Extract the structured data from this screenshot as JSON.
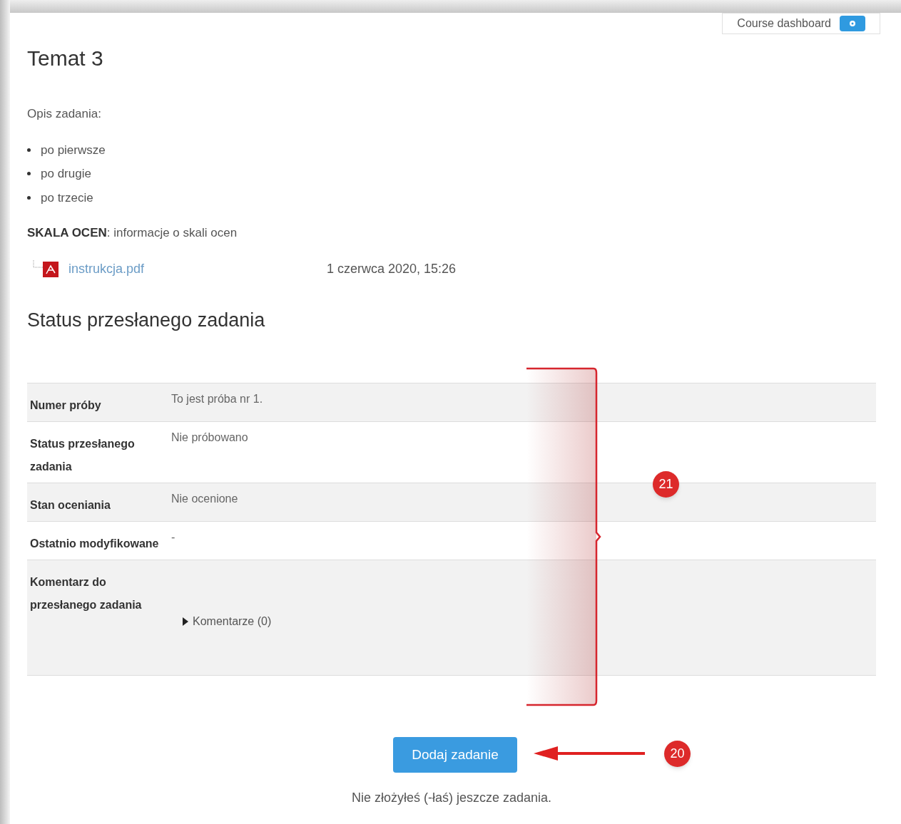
{
  "header_button": {
    "label": "Course dashboard"
  },
  "title": "Temat 3",
  "description": {
    "heading": "Opis zadania:",
    "items": [
      "po pierwsze",
      "po drugie",
      "po trzecie"
    ],
    "note": "**SKALA OCEN**: informacje o skali ocen"
  },
  "attachment": {
    "file": "instrukcja.pdf",
    "date": "1 czerwca 2020, 15:26"
  },
  "status_heading": "Status przesłanego zadania",
  "status_table": [
    {
      "label": "Numer próby",
      "value": "To jest próba nr 1.",
      "kind": "text"
    },
    {
      "label": "Status przesłanego zadania",
      "value": "Nie próbowano",
      "kind": "text"
    },
    {
      "label": "Stan oceniania",
      "value": "Nie ocenione",
      "kind": "text"
    },
    {
      "label": "Ostatnio modyfikowane",
      "value": "-",
      "kind": "text"
    },
    {
      "label": "Komentarz do przesłanego zadania",
      "value": "Komentarze (0)",
      "kind": "comments",
      "expanded": false
    }
  ],
  "submit_button": "Dodaj zadanie",
  "submit_note": "Nie złożyłeś (-łaś) jeszcze zadania.",
  "annotations": [
    {
      "label": "21",
      "kind": "bracket"
    },
    {
      "label": "20",
      "kind": "arrow"
    }
  ]
}
